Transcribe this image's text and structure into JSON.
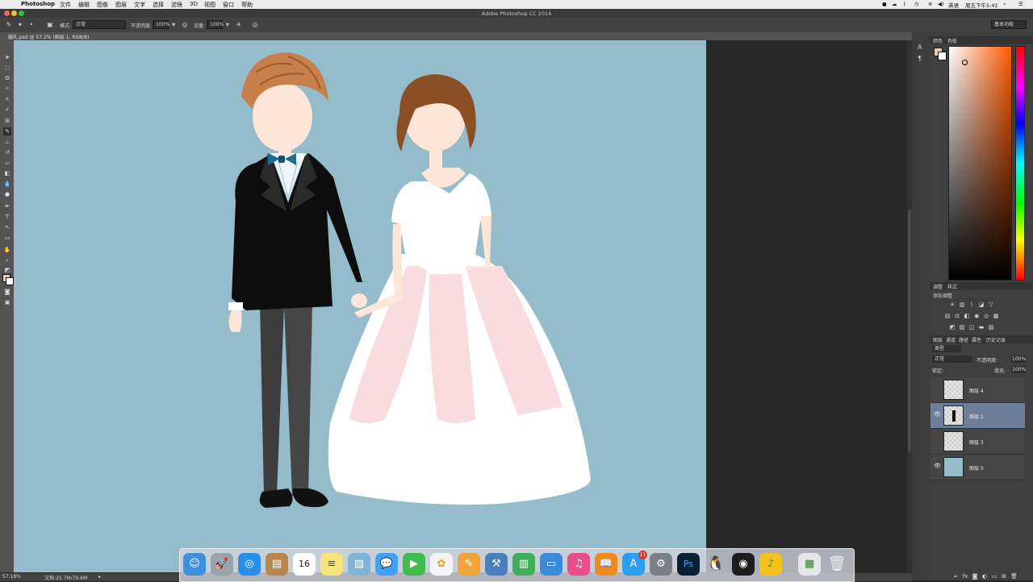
{
  "menubar": {
    "app_name": "Photoshop",
    "items": [
      "文件",
      "编辑",
      "图像",
      "图层",
      "文字",
      "选择",
      "滤镜",
      "3D",
      "视图",
      "窗口",
      "帮助"
    ],
    "input_method": "英语",
    "clock": "周五下午5:41"
  },
  "window": {
    "title": "Adobe Photoshop CC 2014"
  },
  "options_bar": {
    "mode_label": "模式:",
    "mode_value": "正常",
    "opacity_label": "不透明度:",
    "opacity_value": "100%",
    "flow_label": "流量:",
    "flow_value": "100%",
    "workspace": "基本功能"
  },
  "document": {
    "tab_title": "婚礼.psd @ 57.2% (图层 1, RGB/8)"
  },
  "status": {
    "zoom": "57.18%",
    "doc_size": "文档:25.7M/79.6M"
  },
  "panels": {
    "color_tabs": [
      "颜色",
      "色板"
    ],
    "adjust_tabs": [
      "调整",
      "样式"
    ],
    "adjust_title": "添加调整",
    "layer_tabs": [
      "图层",
      "通道",
      "路径",
      "属性",
      "历史记录"
    ],
    "kind_filter": "类型",
    "blend_mode": "正常",
    "opacity_label": "不透明度:",
    "opacity_value": "100%",
    "lock_label": "锁定:",
    "fill_label": "填充:",
    "fill_value": "100%"
  },
  "layers": [
    {
      "name": "图层 4",
      "visible": false,
      "selected": false
    },
    {
      "name": "图层 1",
      "visible": true,
      "selected": true
    },
    {
      "name": "图层 3",
      "visible": false,
      "selected": false
    },
    {
      "name": "图层 0",
      "visible": true,
      "selected": false
    }
  ],
  "colors": {
    "canvas": "#95bcca",
    "foreground": "#e9cdae",
    "selected_layer": "#6e7d99"
  },
  "dock": {
    "badge": "11",
    "calendar_day": "16",
    "apps": [
      "finder-icon",
      "launchpad-icon",
      "safari-icon",
      "contacts-icon",
      "calendar-icon",
      "notes-icon",
      "preview-icon",
      "messages-icon",
      "facetime-icon",
      "photos-icon",
      "pages-icon",
      "xcode-icon",
      "numbers-icon",
      "keynote-icon",
      "itunes-icon",
      "ibooks-icon",
      "app-store-icon",
      "system-preferences-icon",
      "photoshop-icon",
      "qq-icon",
      "quicktime-icon",
      "qq-music-icon",
      "photo-booth-icon",
      "trash-icon"
    ]
  }
}
